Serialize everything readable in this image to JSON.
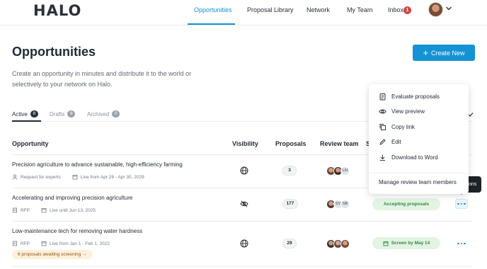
{
  "app": {
    "logo_text": "HALO"
  },
  "nav": {
    "items": [
      {
        "label": "Opportunities"
      },
      {
        "label": "Proposal Library"
      },
      {
        "label": "Network"
      },
      {
        "label": "My Team"
      },
      {
        "label": "Inbox"
      }
    ],
    "inbox_badge": "1"
  },
  "page": {
    "title": "Opportunities",
    "description": "Create an opportunity in minutes and distribute it to the world or selectively to your network on Halo.",
    "create_button": "Create New"
  },
  "tabs": [
    {
      "label": "Active",
      "count": "8"
    },
    {
      "label": "Drafts",
      "count": "8"
    },
    {
      "label": "Archived",
      "count": "0"
    }
  ],
  "table": {
    "headers": {
      "opportunity": "Opportunity",
      "visibility": "Visibility",
      "proposals": "Proposals",
      "review_team": "Review team",
      "status": "S"
    },
    "rows": [
      {
        "title": "Precision agriculture to advance sustainable, high-efficiency farming",
        "type": "Request for experts",
        "dates": "Live from Apr 28 - Apr 30, 2029",
        "visibility_icon": "globe-icon",
        "proposals": "3",
        "review_initials": [
          "LN"
        ]
      },
      {
        "title": "Accelerating and improving precision agriculture",
        "type": "RFP",
        "dates": "Live until Jun 13, 2025",
        "visibility_icon": "eye-off-icon",
        "proposals": "177",
        "review_initials": [
          "SV",
          "SB"
        ],
        "status": "Accepting proposals"
      },
      {
        "title": "Low-maintenance tech for removing water hardness",
        "type": "RFP",
        "dates": "Live from Jan 1 - Feb 1, 2022",
        "visibility_icon": "globe-icon",
        "proposals": "29",
        "review_initials": [],
        "status": "Screen by May 14",
        "screening_note": "6 proposals awaiting screening →"
      }
    ]
  },
  "menu": {
    "items": [
      {
        "label": "Evaluate proposals",
        "icon": "clipboard-icon"
      },
      {
        "label": "View preview",
        "icon": "eye-icon"
      },
      {
        "label": "Copy link",
        "icon": "copy-icon"
      },
      {
        "label": "Edit",
        "icon": "pencil-icon"
      },
      {
        "label": "Download to Word",
        "icon": "download-icon"
      }
    ],
    "manage_label": "Manage review team members"
  },
  "tooltip": {
    "text": "ons"
  },
  "colors": {
    "accent": "#1592d3",
    "status_green": "#2f8a3e",
    "status_green_bg": "#e3f4e3",
    "badge_red": "#d64545"
  }
}
